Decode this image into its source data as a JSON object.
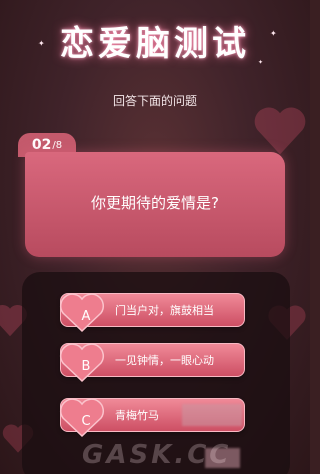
{
  "header": {
    "title": "恋爱脑测试",
    "subtitle": "回答下面的问题"
  },
  "question": {
    "current": "02",
    "total": "/8",
    "text": "你更期待的爱情是?"
  },
  "options": [
    {
      "letter": "A",
      "text": "门当户对，旗鼓相当"
    },
    {
      "letter": "B",
      "text": "一见钟情，一眼心动"
    },
    {
      "letter": "C",
      "text": "青梅竹马"
    }
  ],
  "watermark": "GASK.CC",
  "colors": {
    "background": "#3a1f22",
    "card": "#c9596d",
    "option": "#e06a7c",
    "title_glow": "#ff78a0"
  }
}
